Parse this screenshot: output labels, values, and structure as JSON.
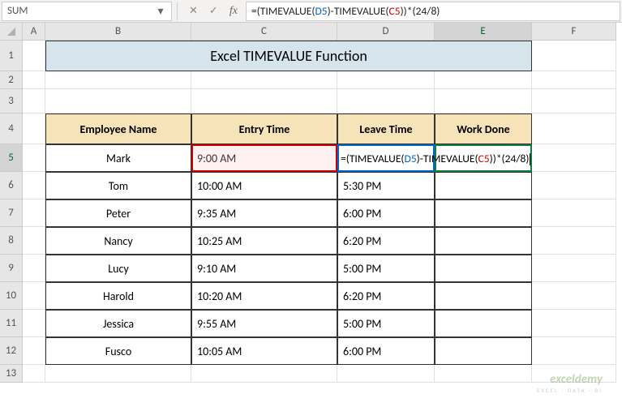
{
  "name_box": "SUM",
  "formula": {
    "pre1": "=(TIMEVALUE(",
    "d5": "D5",
    "mid": ")-TIMEVALUE(",
    "c5": "C5",
    "post": "))*(24/8)"
  },
  "columns": [
    "A",
    "B",
    "C",
    "D",
    "E",
    "F"
  ],
  "title": "Excel TIMEVALUE Function",
  "headers": {
    "employee": "Employee Name",
    "entry": "Entry Time",
    "leave": "Leave Time",
    "work": "Work Done"
  },
  "rows": [
    {
      "name": "Mark",
      "entry": "9:00 AM",
      "leave": ""
    },
    {
      "name": "Tom",
      "entry": "10:00 AM",
      "leave": "5:30 PM"
    },
    {
      "name": "Peter",
      "entry": "9:35 AM",
      "leave": "6:00 PM"
    },
    {
      "name": "Nancy",
      "entry": "10:25 AM",
      "leave": "6:20 PM"
    },
    {
      "name": "Lucy",
      "entry": "9:10 AM",
      "leave": "5:00 PM"
    },
    {
      "name": "Harold",
      "entry": "10:20 AM",
      "leave": "6:20 PM"
    },
    {
      "name": "Jessica",
      "entry": "9:55 AM",
      "leave": "5:00 PM"
    },
    {
      "name": "Fusco",
      "entry": "10:05 AM",
      "leave": "6:00 PM"
    }
  ],
  "row_nums": [
    "1",
    "2",
    "3",
    "4",
    "5",
    "6",
    "7",
    "8",
    "9",
    "10",
    "11",
    "12",
    "13"
  ],
  "watermark": {
    "brand": "exceldemy",
    "tag": "EXCEL · DATA · BI"
  }
}
